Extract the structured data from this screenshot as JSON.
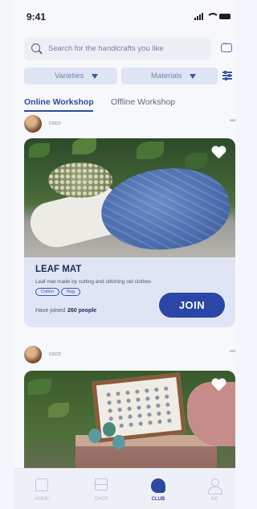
{
  "status_bar": {
    "time": "9:41"
  },
  "search": {
    "placeholder": "Search for the handicrafts you like"
  },
  "filters": [
    {
      "label": "Varieties"
    },
    {
      "label": "Materials"
    }
  ],
  "tabs": [
    {
      "label": "Online Workshop",
      "active": true
    },
    {
      "label": "Offline Workshop",
      "active": false
    }
  ],
  "posts": [
    {
      "author": "coco",
      "title": "LEAF MAT",
      "description": "Leaf mat made by cutting and stitching old clothes",
      "tags": [
        "Cotton",
        "Bag"
      ],
      "joined_label": "Have joined",
      "joined_count": "260 people",
      "join_label": "JOIN"
    },
    {
      "author": "coco"
    }
  ],
  "bottom_nav": [
    {
      "label": "HOME",
      "icon": "shirt-icon"
    },
    {
      "label": "SHOP",
      "icon": "shop-icon"
    },
    {
      "label": "CLUB",
      "icon": "hand-icon",
      "active": true
    },
    {
      "label": "ME",
      "icon": "user-icon"
    }
  ],
  "colors": {
    "accent": "#2e4aa0",
    "join_button": "#2a46a6",
    "card_bg": "#dfe5f4",
    "filter_bg": "#dfe4f4"
  }
}
